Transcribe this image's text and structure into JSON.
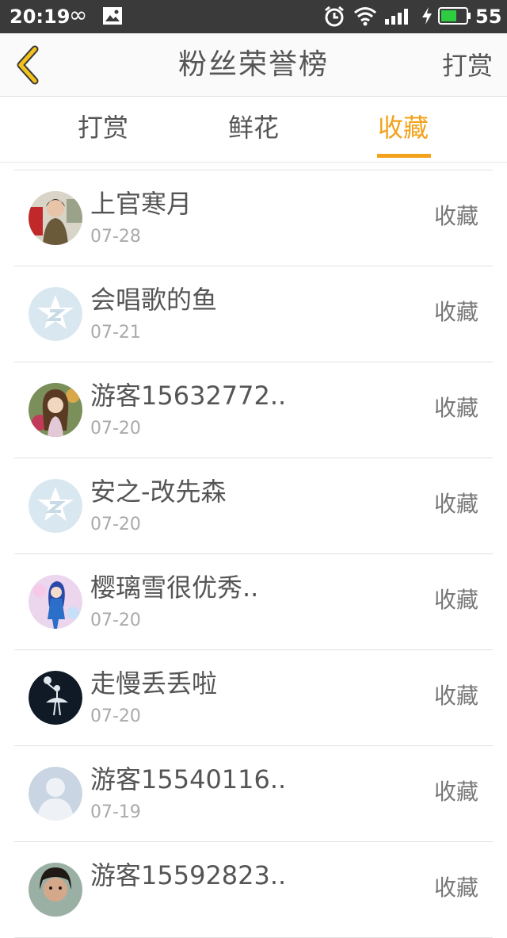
{
  "status_bar": {
    "time": "20:19",
    "infinity_glyph": "∞",
    "battery_percent": "55",
    "icons": [
      "infinity-icon",
      "image-icon",
      "alarm-icon",
      "wifi-icon",
      "signal-icon",
      "charging-icon",
      "battery-icon"
    ]
  },
  "header": {
    "title": "粉丝荣誉榜",
    "action_label": "打赏",
    "back_icon": "chevron-left-icon"
  },
  "tabs": [
    {
      "label": "打赏",
      "active": false
    },
    {
      "label": "鲜花",
      "active": false
    },
    {
      "label": "收藏",
      "active": true
    }
  ],
  "accent_color": "#f3a21b",
  "fans": [
    {
      "name": "上官寒月",
      "date": "07-28",
      "action": "收藏",
      "avatar": "photo-girl"
    },
    {
      "name": "会唱歌的鱼",
      "date": "07-21",
      "action": "收藏",
      "avatar": "qq-star"
    },
    {
      "name": "游客15632772..",
      "date": "07-20",
      "action": "收藏",
      "avatar": "anime-girl"
    },
    {
      "name": "安之-改先森",
      "date": "07-20",
      "action": "收藏",
      "avatar": "qq-star"
    },
    {
      "name": "樱璃雪很优秀..",
      "date": "07-20",
      "action": "收藏",
      "avatar": "anime-blue"
    },
    {
      "name": "走慢丢丢啦",
      "date": "07-20",
      "action": "收藏",
      "avatar": "dancer-dark"
    },
    {
      "name": "游客15540116..",
      "date": "07-19",
      "action": "收藏",
      "avatar": "default-user"
    },
    {
      "name": "游客15592823..",
      "date": "",
      "action": "收藏",
      "avatar": "photo-kid"
    }
  ]
}
